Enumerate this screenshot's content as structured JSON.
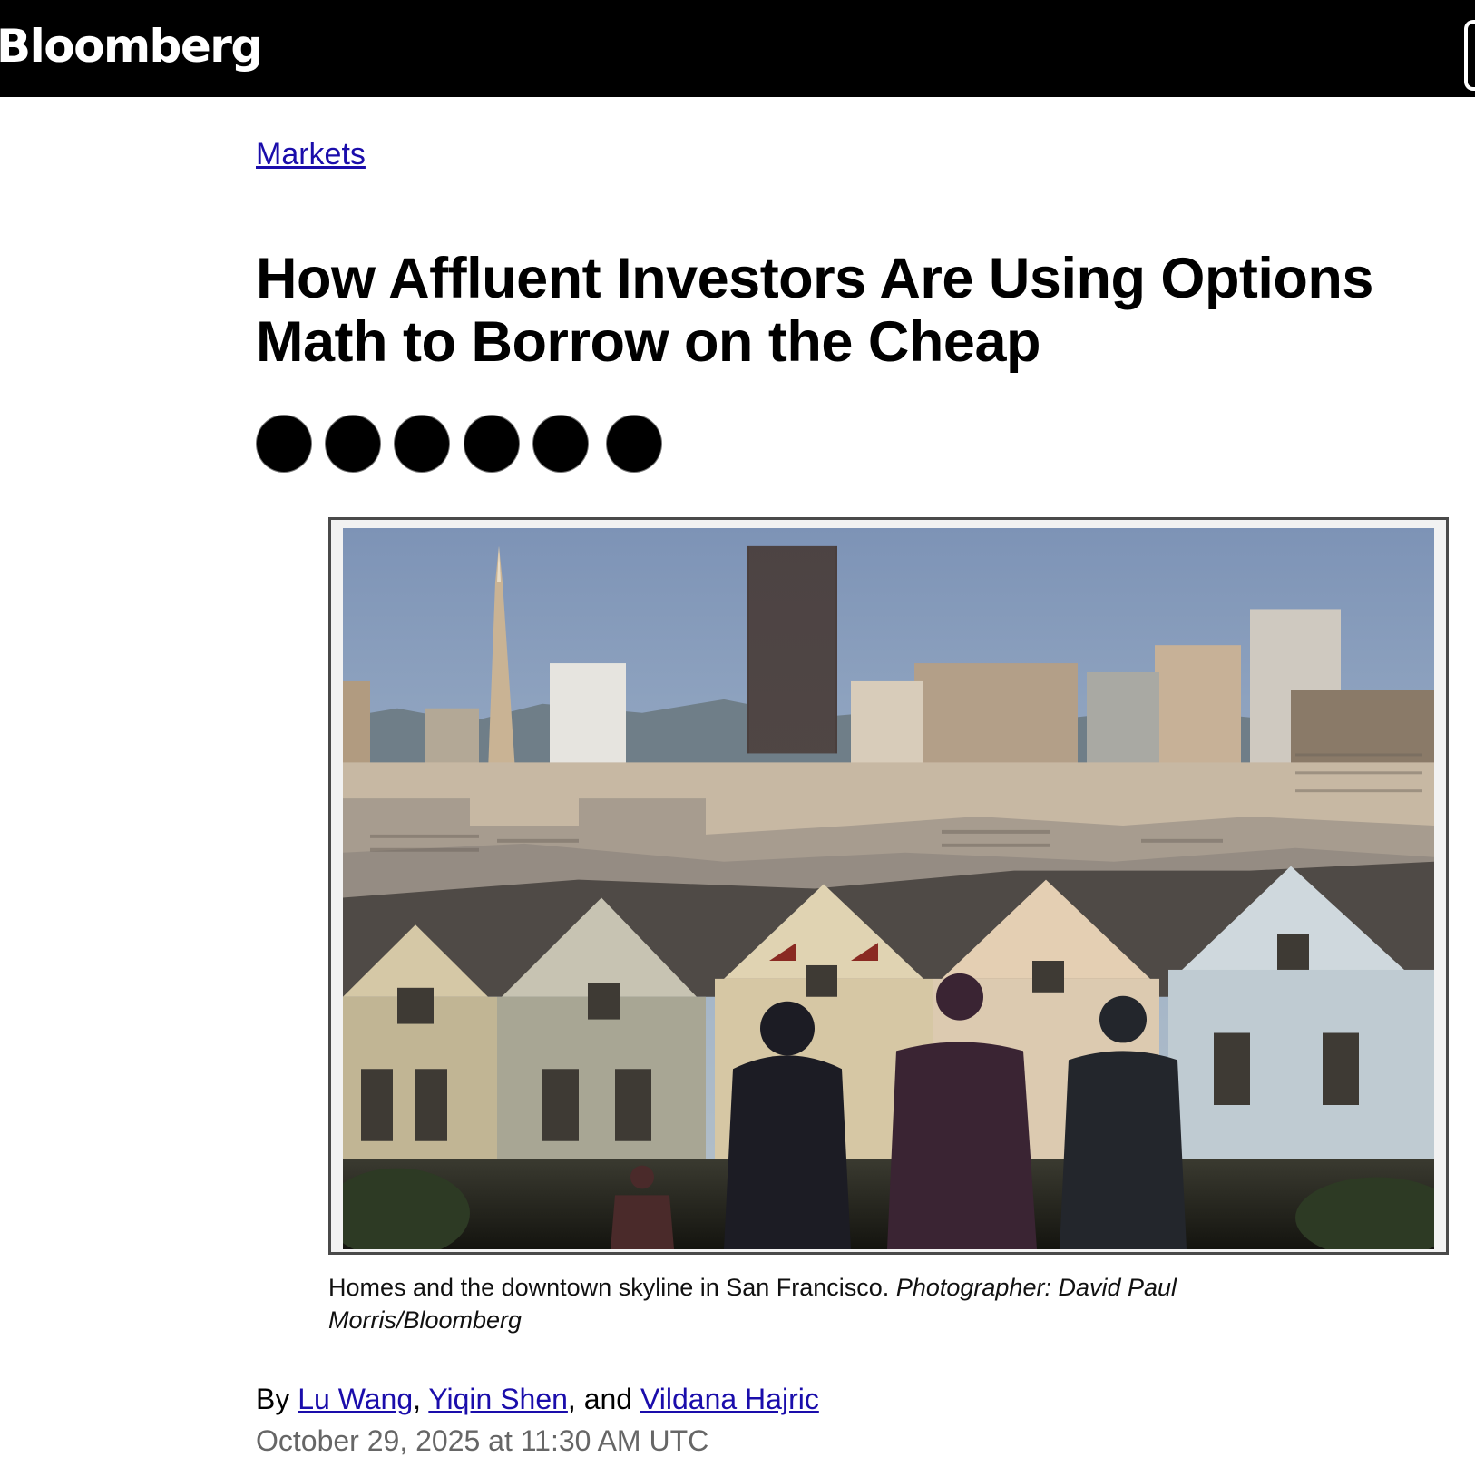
{
  "header": {
    "brand": "Bloomberg"
  },
  "article": {
    "section": "Markets",
    "headline": "How Affluent Investors Are Using Options Math to Borrow on the Cheap",
    "share_buttons": [
      "share-1",
      "share-2",
      "share-3",
      "share-4",
      "share-5",
      "share-6"
    ],
    "image": {
      "alt": "Homes and the downtown skyline in San Francisco.",
      "caption": "Homes and the downtown skyline in San Francisco.",
      "credit": "Photographer: David Paul Morris/Bloomberg"
    },
    "byline": {
      "prefix": "By",
      "authors": [
        "Lu Wang",
        "Yiqin Shen",
        "Vildana Hajric"
      ],
      "sep1": ",",
      "sep2": ", and"
    },
    "date": "October 29, 2025 at 11:30 AM UTC"
  },
  "colors": {
    "link": "#1a0dab",
    "topbar": "#000000",
    "date": "#666666"
  }
}
